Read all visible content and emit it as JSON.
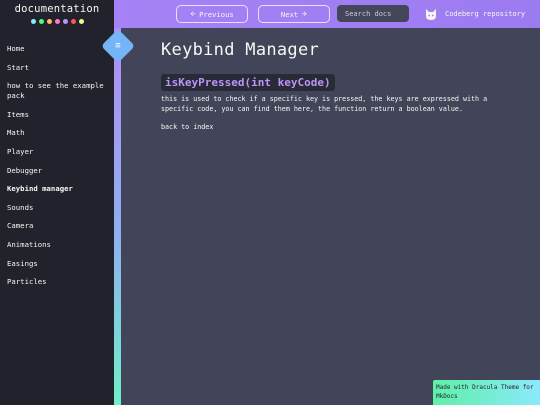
{
  "brand": {
    "title": "documentation",
    "dot_colors": [
      "#8be9fd",
      "#50fa7b",
      "#ffb86c",
      "#ff79c6",
      "#bd93f9",
      "#ff5555",
      "#f1fa8c"
    ]
  },
  "topbar": {
    "previous_label": "Previous",
    "next_label": "Next",
    "search_placeholder": "Search docs",
    "repo_label": "Codeberg repository"
  },
  "sidebar": {
    "items": [
      {
        "label": "Home"
      },
      {
        "label": "Start"
      },
      {
        "label": "how to see the example pack"
      },
      {
        "label": "Items"
      },
      {
        "label": "Math"
      },
      {
        "label": "Player"
      },
      {
        "label": "Debugger"
      },
      {
        "label": "Keybind manager"
      },
      {
        "label": "Sounds"
      },
      {
        "label": "Camera"
      },
      {
        "label": "Animations"
      },
      {
        "label": "Easings"
      },
      {
        "label": "Particles"
      }
    ],
    "active_item": "Keybind manager"
  },
  "main": {
    "title": "Keybind Manager",
    "function_signature": "isKeyPressed(int keyCode)",
    "description": "this is used to check if a specific key is pressed, the keys are expressed with a specific code, you can find them here, the function return a boolean value.",
    "back_link": "back to index"
  },
  "footer": {
    "badge_text": "Made with Dracula Theme for MkDocs"
  },
  "colors": {
    "accent": "#bd93f9",
    "background": "#424559",
    "sidebar": "#21222c"
  }
}
